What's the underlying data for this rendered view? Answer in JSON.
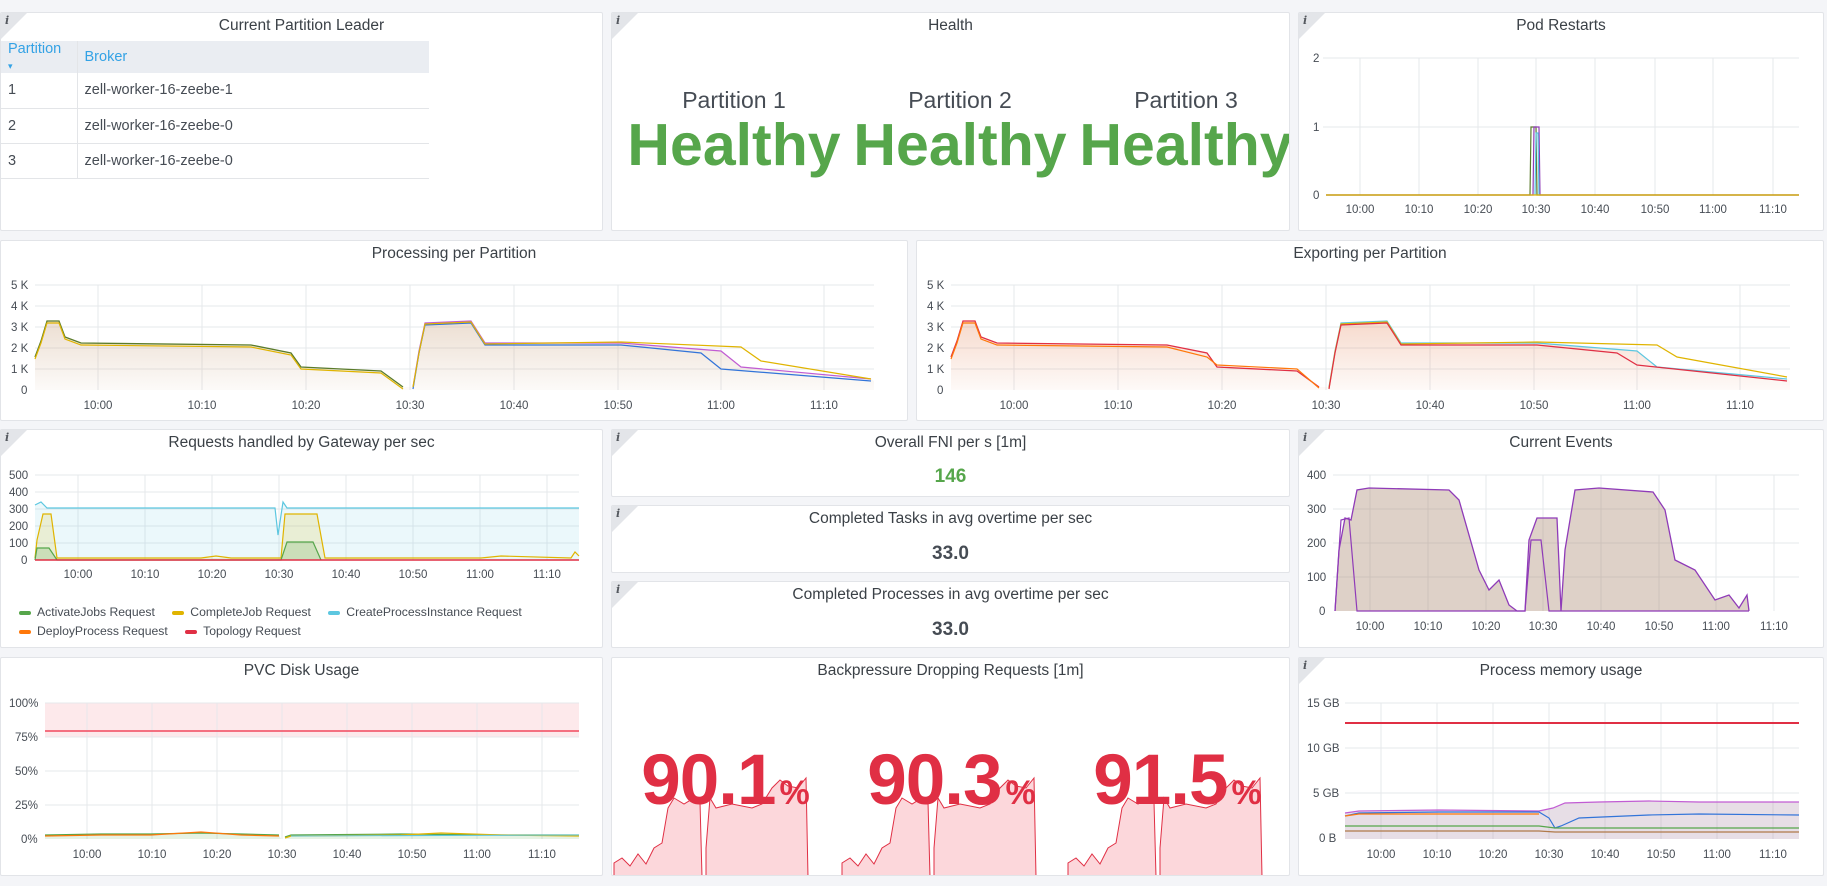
{
  "colors": {
    "green": "#56a64b",
    "yellow": "#e0b400",
    "cyan": "#5dc7e0",
    "orange": "#ff780a",
    "red": "#e02f44",
    "purple": "#8f3bb8",
    "blue": "#3274d9",
    "magenta": "#c15cd3",
    "olive": "#5a7b2a",
    "brown": "#b07a4a"
  },
  "leader": {
    "title": "Current Partition Leader",
    "col_partition": "Partition",
    "col_broker": "Broker",
    "rows": [
      {
        "partition": "1",
        "broker": "zell-worker-16-zeebe-1"
      },
      {
        "partition": "2",
        "broker": "zell-worker-16-zeebe-0"
      },
      {
        "partition": "3",
        "broker": "zell-worker-16-zeebe-0"
      }
    ]
  },
  "health": {
    "title": "Health",
    "cells": [
      {
        "name": "Partition 1",
        "value": "Healthy"
      },
      {
        "name": "Partition 2",
        "value": "Healthy"
      },
      {
        "name": "Partition 3",
        "value": "Healthy"
      }
    ]
  },
  "restarts": {
    "title": "Pod Restarts",
    "yticks": [
      "2",
      "1",
      "0"
    ],
    "xticks": [
      "10:00",
      "10:10",
      "10:20",
      "10:30",
      "10:40",
      "10:50",
      "11:00",
      "11:10"
    ]
  },
  "processing": {
    "title": "Processing per Partition",
    "yticks": [
      "5 K",
      "4 K",
      "3 K",
      "2 K",
      "1 K",
      "0"
    ],
    "xticks": [
      "10:00",
      "10:10",
      "10:20",
      "10:30",
      "10:40",
      "10:50",
      "11:00",
      "11:10"
    ]
  },
  "exporting": {
    "title": "Exporting per Partition",
    "yticks": [
      "5 K",
      "4 K",
      "3 K",
      "2 K",
      "1 K",
      "0"
    ],
    "xticks": [
      "10:00",
      "10:10",
      "10:20",
      "10:30",
      "10:40",
      "10:50",
      "11:00",
      "11:10"
    ]
  },
  "gateway": {
    "title": "Requests handled by Gateway per sec",
    "yticks": [
      "500",
      "400",
      "300",
      "200",
      "100",
      "0"
    ],
    "xticks": [
      "10:00",
      "10:10",
      "10:20",
      "10:30",
      "10:40",
      "10:50",
      "11:00",
      "11:10"
    ],
    "legend": [
      {
        "label": "ActivateJobs Request",
        "color": "#56a64b"
      },
      {
        "label": "CompleteJob Request",
        "color": "#e0b400"
      },
      {
        "label": "CreateProcessInstance Request",
        "color": "#5dc7e0"
      },
      {
        "label": "DeployProcess Request",
        "color": "#ff780a"
      },
      {
        "label": "Topology Request",
        "color": "#e02f44"
      }
    ]
  },
  "fni": {
    "title": "Overall FNI per s [1m]",
    "value": "146"
  },
  "tasks": {
    "title": "Completed Tasks in avg overtime per sec",
    "value": "33.0"
  },
  "processes": {
    "title": "Completed Processes in avg overtime per sec",
    "value": "33.0"
  },
  "events": {
    "title": "Current Events",
    "yticks": [
      "400",
      "300",
      "200",
      "100",
      "0"
    ],
    "xticks": [
      "10:00",
      "10:10",
      "10:20",
      "10:30",
      "10:40",
      "10:50",
      "11:00",
      "11:10"
    ]
  },
  "pvc": {
    "title": "PVC Disk Usage",
    "yticks": [
      "100%",
      "75%",
      "50%",
      "25%",
      "0%"
    ],
    "xticks": [
      "10:00",
      "10:10",
      "10:20",
      "10:30",
      "10:40",
      "10:50",
      "11:00",
      "11:10"
    ]
  },
  "backpressure": {
    "title": "Backpressure Dropping Requests [1m]",
    "unit": "%",
    "values": [
      "90.1",
      "90.3",
      "91.5"
    ]
  },
  "memory": {
    "title": "Process memory usage",
    "yticks": [
      "15 GB",
      "10 GB",
      "5 GB",
      "0 B"
    ],
    "xticks": [
      "10:00",
      "10:10",
      "10:20",
      "10:30",
      "10:40",
      "10:50",
      "11:00",
      "11:10"
    ]
  },
  "chart_data": [
    {
      "type": "line",
      "title": "Pod Restarts",
      "ylim": [
        0,
        2
      ],
      "x": [
        "10:00",
        "10:10",
        "10:20",
        "10:30",
        "10:40",
        "10:50",
        "11:00",
        "11:10"
      ],
      "series": [
        {
          "values": [
            0,
            0,
            0,
            1,
            0,
            0,
            0,
            0
          ]
        }
      ]
    },
    {
      "type": "area",
      "title": "Processing per Partition",
      "ylim": [
        0,
        5000
      ],
      "x": [
        "10:00",
        "10:10",
        "10:20",
        "10:30",
        "10:40",
        "10:50",
        "11:00",
        "11:10"
      ],
      "series": [
        {
          "values": [
            2200,
            2200,
            1800,
            800,
            3300,
            2200,
            2100,
            800
          ]
        }
      ]
    },
    {
      "type": "area",
      "title": "Exporting per Partition",
      "ylim": [
        0,
        5000
      ],
      "x": [
        "10:00",
        "10:10",
        "10:20",
        "10:30",
        "10:40",
        "10:50",
        "11:00",
        "11:10"
      ],
      "series": [
        {
          "values": [
            2200,
            2200,
            1900,
            800,
            3300,
            2200,
            2100,
            800
          ]
        }
      ]
    },
    {
      "type": "area",
      "title": "Requests handled by Gateway per sec",
      "ylim": [
        0,
        500
      ],
      "x": [
        "10:00",
        "10:10",
        "10:20",
        "10:30",
        "10:40",
        "10:50",
        "11:00",
        "11:10"
      ],
      "series": [
        {
          "name": "ActivateJobs Request",
          "values": [
            0,
            0,
            0,
            120,
            0,
            0,
            0,
            0
          ]
        },
        {
          "name": "CompleteJob Request",
          "values": [
            0,
            0,
            0,
            280,
            0,
            0,
            0,
            0
          ]
        },
        {
          "name": "CreateProcessInstance Request",
          "values": [
            340,
            340,
            340,
            340,
            340,
            340,
            340,
            340
          ]
        },
        {
          "name": "DeployProcess Request",
          "values": [
            0,
            0,
            0,
            0,
            0,
            0,
            0,
            0
          ]
        },
        {
          "name": "Topology Request",
          "values": [
            0,
            0,
            0,
            0,
            0,
            0,
            0,
            0
          ]
        }
      ]
    },
    {
      "type": "area",
      "title": "Current Events",
      "ylim": [
        0,
        400
      ],
      "x": [
        "10:00",
        "10:10",
        "10:20",
        "10:30",
        "10:40",
        "10:50",
        "11:00",
        "11:10"
      ],
      "series": [
        {
          "values": [
            330,
            320,
            50,
            40,
            330,
            320,
            70,
            20
          ]
        }
      ]
    },
    {
      "type": "area",
      "title": "PVC Disk Usage",
      "ylim": [
        0,
        100
      ],
      "x": [
        "10:00",
        "10:10",
        "10:20",
        "10:30",
        "10:40",
        "10:50",
        "11:00",
        "11:10"
      ],
      "series": [
        {
          "values": [
            3,
            3,
            4,
            3,
            3,
            3,
            3,
            3
          ]
        }
      ]
    },
    {
      "type": "area",
      "title": "Process memory usage",
      "ylim": [
        0,
        15
      ],
      "x": [
        "10:00",
        "10:10",
        "10:20",
        "10:30",
        "10:40",
        "10:50",
        "11:00",
        "11:10"
      ],
      "series": [
        {
          "values": [
            12.9,
            12.9,
            12.9,
            12.9,
            12.9,
            12.9,
            12.9,
            12.9
          ]
        },
        {
          "values": [
            3,
            3,
            3,
            3,
            4,
            4,
            4,
            4
          ]
        },
        {
          "values": [
            1,
            1,
            1,
            1,
            1,
            1,
            1,
            1
          ]
        }
      ]
    }
  ]
}
